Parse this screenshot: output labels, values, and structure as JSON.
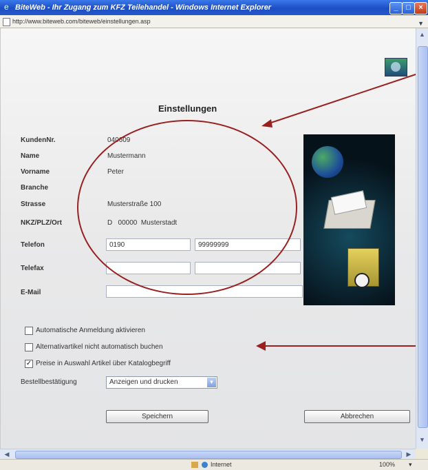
{
  "window": {
    "title": "BiteWeb - Ihr Zugang zum KFZ Teilehandel - Windows Internet Explorer",
    "address": "http://www.biteweb.com/biteweb/einstellungen.asp",
    "buttons": {
      "minimize": "_",
      "maximize": "□",
      "close": "×"
    }
  },
  "page": {
    "title": "Einstellungen"
  },
  "customer": {
    "labels": {
      "customer_no": "KundenNr.",
      "name": "Name",
      "first_name": "Vorname",
      "branch": "Branche",
      "street": "Strasse",
      "location": "NKZ/PLZ/Ort",
      "phone": "Telefon",
      "fax": "Telefax",
      "email": "E-Mail"
    },
    "values": {
      "customer_no": "040609",
      "name": "Mustermann",
      "first_name": "Peter",
      "branch": "",
      "street": "Musterstraße 100",
      "location": "D   00000  Musterstadt"
    }
  },
  "fields": {
    "phone_area": "0190",
    "phone_number": "99999999",
    "fax_area": "",
    "fax_number": "",
    "email": ""
  },
  "options": [
    {
      "label": "Automatische Anmeldung aktivieren",
      "checked": false
    },
    {
      "label": "Alternativartikel nicht automatisch buchen",
      "checked": false
    },
    {
      "label": "Preise in Auswahl Artikel über Katalogbegriff",
      "checked": true
    }
  ],
  "order_confirmation": {
    "label": "Bestellbestätigung",
    "selected": "Anzeigen und drucken"
  },
  "actions": {
    "save": "Speichern",
    "cancel": "Abbrechen"
  },
  "statusbar": {
    "zone": "Internet",
    "zoom": "100%",
    "zoom_dropdown": "▾"
  }
}
